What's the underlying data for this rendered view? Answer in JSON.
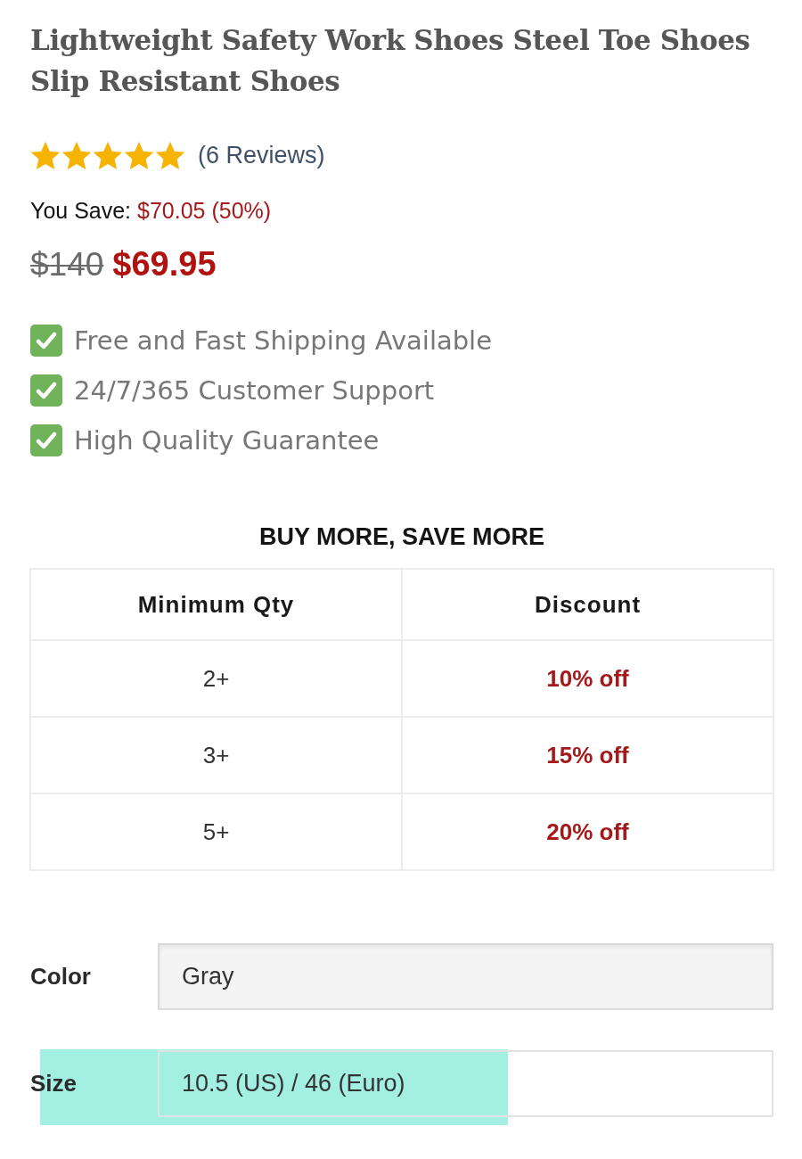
{
  "product": {
    "title": "Lightweight Safety Work Shoes Steel Toe Shoes Slip Resistant Shoes"
  },
  "rating": {
    "stars": 5,
    "reviews": "(6 Reviews)"
  },
  "savings": {
    "label": "You Save:",
    "amount": "$70.05 (50%)"
  },
  "price": {
    "old": "$140",
    "current": "$69.95"
  },
  "features": [
    {
      "text": "Free and Fast Shipping Available",
      "checked": true
    },
    {
      "text": "24/7/365 Customer Support",
      "checked": true
    },
    {
      "text": "High Quality Guarantee",
      "checked": true
    }
  ],
  "bulk_discount": {
    "title": "BUY MORE, SAVE MORE",
    "columns": [
      "Minimum Qty",
      "Discount"
    ],
    "rows": [
      [
        "2+",
        "10% off"
      ],
      [
        "3+",
        "15% off"
      ],
      [
        "5+",
        "20% off"
      ]
    ]
  },
  "options": [
    {
      "label": "Color",
      "value": "Gray",
      "focused": false,
      "highlighted": false
    },
    {
      "label": "Size",
      "value": "10.5 (US) / 46 (Euro)",
      "focused": true,
      "highlighted": true
    }
  ]
}
